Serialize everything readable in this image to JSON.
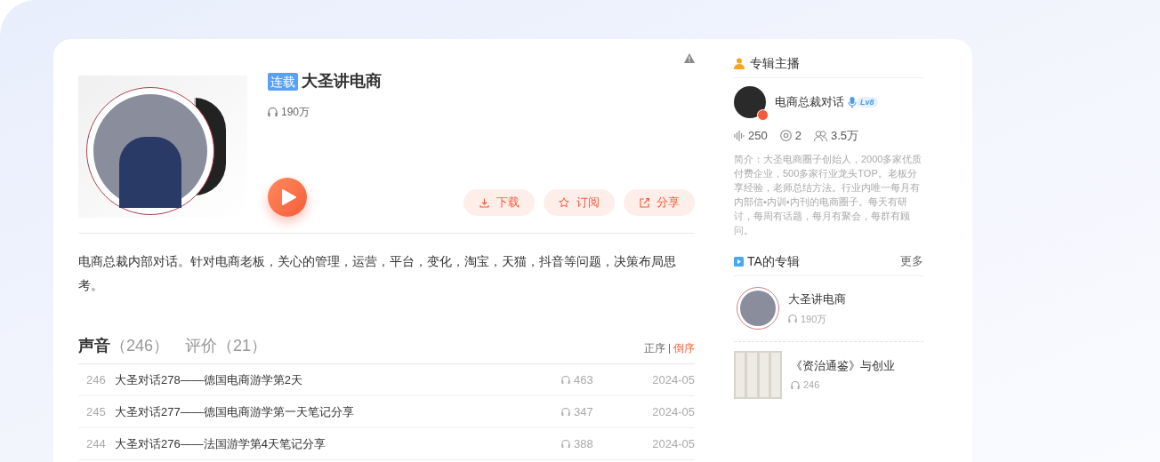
{
  "album": {
    "badge": "连载",
    "title": "大圣讲电商",
    "plays": "190万",
    "description": "电商总裁内部对话。针对电商老板，关心的管理，运营，平台，变化，淘宝，天猫，抖音等问题，决策布局思考。",
    "actions": [
      {
        "kind": "download",
        "label": "下载"
      },
      {
        "kind": "subscribe",
        "label": "订阅"
      },
      {
        "kind": "share",
        "label": "分享"
      }
    ]
  },
  "tabs": [
    {
      "label": "声音",
      "count": "（246）",
      "selected": true
    },
    {
      "label": "评价",
      "count": "（21）",
      "selected": false
    }
  ],
  "sort": [
    {
      "label": "正序",
      "selected": false
    },
    {
      "label": "倒序",
      "selected": true
    }
  ],
  "tracks": [
    {
      "number": "246",
      "title": "大圣对话278——德国电商游学第2天",
      "plays": "463",
      "date": "2024-05"
    },
    {
      "number": "245",
      "title": "大圣对话277——德国电商游学第一天笔记分享",
      "plays": "347",
      "date": "2024-05"
    },
    {
      "number": "244",
      "title": "大圣对话276——法国游学第4天笔记分享",
      "plays": "388",
      "date": "2024-05"
    }
  ],
  "host": {
    "heading": "专辑主播",
    "name": "电商总裁对话",
    "level": "Lv8",
    "tracks": "250",
    "albums": "2",
    "followers": "3.5万",
    "bio": "简介：大圣电商圈子创始人，2000多家优质付费企业，500多家行业龙头TOP。老板分享经验，老师总结方法。行业内唯一每月有内部信•内训•内刊的电商圈子。每天有研讨，每周有话题，每月有聚会，每群有顾问。"
  },
  "other_albums": {
    "heading": "TA的专辑",
    "more": "更多",
    "items": [
      {
        "kind": "round",
        "title": "大圣讲电商",
        "plays": "190万"
      },
      {
        "kind": "square",
        "title": "《资治通鉴》与创业",
        "plays": "246"
      }
    ]
  }
}
